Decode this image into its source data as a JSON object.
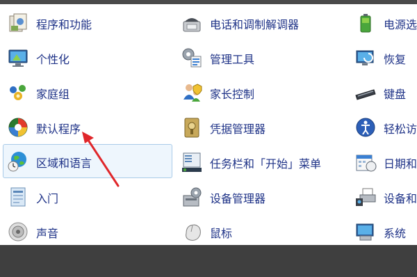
{
  "colors": {
    "link": "#1e3287",
    "highlight_border": "#a9cbe8",
    "highlight_bg": "#eef6fd",
    "arrow": "#e0262a"
  },
  "items": {
    "c0": [
      {
        "label": "程序和功能",
        "icon": "programs-features-icon"
      },
      {
        "label": "个性化",
        "icon": "personalization-icon"
      },
      {
        "label": "家庭组",
        "icon": "homegroup-icon"
      },
      {
        "label": "默认程序",
        "icon": "default-programs-icon"
      },
      {
        "label": "区域和语言",
        "icon": "region-language-icon"
      },
      {
        "label": "入门",
        "icon": "getting-started-icon"
      },
      {
        "label": "声音",
        "icon": "sound-icon"
      }
    ],
    "c1": [
      {
        "label": "电话和调制解调器",
        "icon": "phone-modem-icon"
      },
      {
        "label": "管理工具",
        "icon": "admin-tools-icon"
      },
      {
        "label": "家长控制",
        "icon": "parental-controls-icon"
      },
      {
        "label": "凭据管理器",
        "icon": "credential-manager-icon"
      },
      {
        "label": "任务栏和「开始」菜单",
        "icon": "taskbar-start-icon"
      },
      {
        "label": "设备管理器",
        "icon": "device-manager-icon"
      },
      {
        "label": "鼠标",
        "icon": "mouse-icon"
      }
    ],
    "c2": [
      {
        "label": "电源选",
        "icon": "power-options-icon"
      },
      {
        "label": "恢复",
        "icon": "recovery-icon"
      },
      {
        "label": "键盘",
        "icon": "keyboard-icon"
      },
      {
        "label": "轻松访",
        "icon": "ease-of-access-icon"
      },
      {
        "label": "日期和",
        "icon": "date-time-icon"
      },
      {
        "label": "设备和",
        "icon": "devices-printers-icon"
      },
      {
        "label": "系统",
        "icon": "system-icon"
      }
    ]
  }
}
